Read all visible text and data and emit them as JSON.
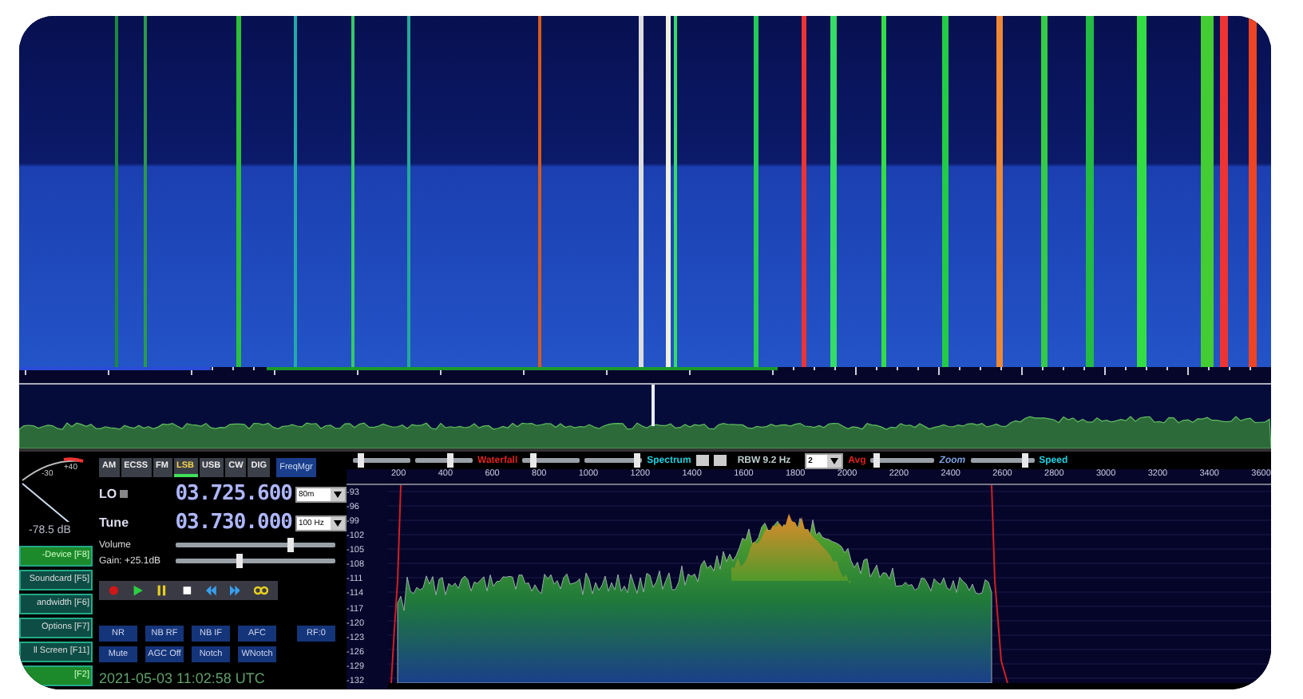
{
  "modes": [
    {
      "label": "AM",
      "selected": false
    },
    {
      "label": "ECSS",
      "selected": false
    },
    {
      "label": "FM",
      "selected": false
    },
    {
      "label": "LSB",
      "selected": true
    },
    {
      "label": "USB",
      "selected": false
    },
    {
      "label": "CW",
      "selected": false
    },
    {
      "label": "DIG",
      "selected": false
    }
  ],
  "freq_manager": "FreqMgr",
  "lo": {
    "label": "LO",
    "value": "03.725.600",
    "band": "80m"
  },
  "tune": {
    "label": "Tune",
    "value": "03.730.000",
    "step": "100 Hz"
  },
  "volume": {
    "label": "Volume",
    "level": 0.72
  },
  "gain": {
    "label": "Gain: +25.1dB",
    "level": 0.4
  },
  "s_meter": {
    "scale": [
      "-30",
      "+40"
    ],
    "reading": "-78.5 dB"
  },
  "function_keys": [
    {
      "label": "-Device [F8]",
      "active": true
    },
    {
      "label": "Soundcard [F5]",
      "active": false
    },
    {
      "label": "andwidth [F6]",
      "active": false
    },
    {
      "label": "Options [F7]",
      "active": false
    },
    {
      "label": "ll Screen [F11]",
      "active": false
    },
    {
      "label": "[F2]",
      "active": true
    }
  ],
  "dsp_buttons": [
    [
      {
        "label": "NR"
      },
      {
        "label": "NB RF"
      },
      {
        "label": "NB IF"
      },
      {
        "label": "AFC"
      },
      {
        "label": "RF:0"
      }
    ],
    [
      {
        "label": "Mute"
      },
      {
        "label": "AGC Off"
      },
      {
        "label": "Notch"
      },
      {
        "label": "WNotch"
      }
    ]
  ],
  "timestamp": "2021-05-03 11:02:58 UTC",
  "toolbar": {
    "waterfall_sliders": [
      {
        "level": 0.15
      },
      {
        "level": 0.6
      }
    ],
    "waterfall_label": "Waterfall",
    "spectrum_sliders": [
      {
        "level": 0.2
      },
      {
        "level": 0.9
      }
    ],
    "spectrum_label": "Spectrum",
    "rbw": "RBW 9.2 Hz",
    "avg_value": "2",
    "avg_label": "Avg",
    "zoom_slider": {
      "level": 0.1
    },
    "zoom_label": "Zoom",
    "speed_slider": {
      "level": 0.85
    },
    "speed_label": "Speed"
  },
  "x_axis_labels": [
    "200",
    "400",
    "600",
    "800",
    "1000",
    "1200",
    "1400",
    "1600",
    "1800",
    "2000",
    "2200",
    "2400",
    "2600",
    "2800",
    "3000",
    "3200",
    "3400",
    "3600"
  ],
  "y_axis_labels": [
    "-93",
    "-96",
    "-99",
    "-102",
    "-105",
    "-108",
    "-111",
    "-114",
    "-117",
    "-120",
    "-123",
    "-126",
    "-129",
    "-132"
  ]
}
